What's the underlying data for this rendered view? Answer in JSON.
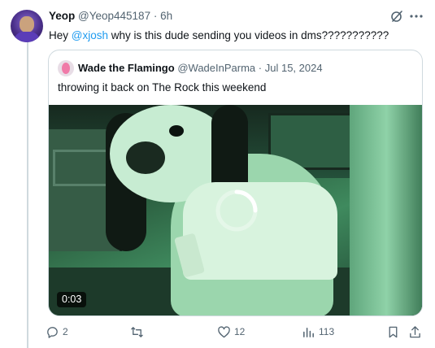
{
  "tweet": {
    "author_name": "Yeop",
    "author_handle": "@Yeop445187",
    "separator": "·",
    "time": "6h",
    "text_before": "Hey ",
    "mention": "@xjosh",
    "text_after": " why is this dude sending you videos in dms???????????"
  },
  "quoted": {
    "author_name": "Wade the Flamingo",
    "author_handle": "@WadeInParma",
    "separator": "·",
    "date": "Jul 15, 2024",
    "text": "throwing it back on The Rock this weekend",
    "video": {
      "timestamp": "0:03",
      "state": "loading"
    }
  },
  "actions": {
    "replies": "2",
    "reposts": "",
    "likes": "12",
    "views": "113"
  },
  "icons": {
    "grok": "grok-icon",
    "more": "more-icon",
    "reply": "reply-icon",
    "repost": "repost-icon",
    "like": "like-icon",
    "views": "views-icon",
    "bookmark": "bookmark-icon",
    "share": "share-icon"
  },
  "colors": {
    "link": "#1d9bf0",
    "muted": "#536471",
    "border": "#cfd9de"
  }
}
